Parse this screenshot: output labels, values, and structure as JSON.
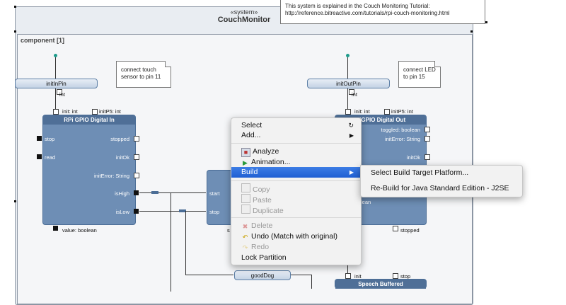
{
  "system": {
    "stereotype": "«system»",
    "name": "CouchMonitor"
  },
  "tutorial_note": {
    "line1": "This system is explained in the Couch Monitoring Tutorial:",
    "line2": "http://reference.bitreactive.com/tutorials/rpi-couch-monitoring.html"
  },
  "component": {
    "label": "component [1]"
  },
  "note_touch": {
    "line1": "connect touch",
    "line2": "sensor to pin 11"
  },
  "note_led": {
    "line1": "connect LED",
    "line2": "to pin 15"
  },
  "init_in_pin": {
    "label": "initInPin",
    "type": "int"
  },
  "init_out_pin": {
    "label": "initOutPin",
    "type": "int"
  },
  "gpio_in": {
    "title": "RPi GPIO Digital In",
    "param_init": "init: int",
    "param_init_p5": "initP5: int",
    "port_stop": "stop",
    "port_read": "read",
    "port_stopped": "stopped",
    "port_init_ok": "initOk",
    "port_init_error": "initError: String",
    "port_is_high": "isHigh",
    "port_is_low": "isLow",
    "port_value": "value: boolean"
  },
  "gpio_out": {
    "title": "PiGPIO Digital Out",
    "param_init": "init: int",
    "param_init_p5": "initP5: int",
    "port_toggled": "toggled: boolean",
    "port_init_error": "initError: String",
    "port_init_ok": "initOk",
    "port_lean": "lean",
    "port_stopped": "stopped"
  },
  "middle_block": {
    "port_start": "start",
    "port_stop": "stop",
    "port_s": "s"
  },
  "good_dog_pin": {
    "label": "goodDog"
  },
  "speech_block": {
    "title": "Speech Buffered",
    "port_init": "init",
    "port_stop": "stop"
  },
  "context_menu": {
    "select": "Select",
    "add": "Add...",
    "analyze": "Analyze",
    "animation": "Animation...",
    "build": "Build",
    "copy": "Copy",
    "paste": "Paste",
    "duplicate": "Duplicate",
    "delete": "Delete",
    "undo": "Undo (Match with original)",
    "redo": "Redo",
    "lock_partition": "Lock Partition"
  },
  "build_submenu": {
    "select_platform": "Select Build Target Platform...",
    "rebuild_j2se": "Re-Build for Java Standard Edition - J2SE"
  },
  "colors": {
    "block": "#6e8eb5",
    "block_title": "#4f6f97",
    "menu_highlight": "#1f5fd3",
    "background": "#e9edf2"
  }
}
